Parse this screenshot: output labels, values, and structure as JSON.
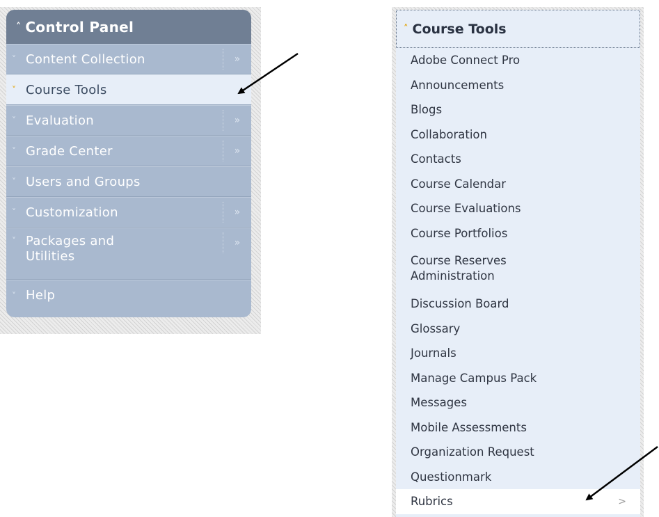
{
  "control_panel": {
    "title": "Control Panel",
    "items": [
      {
        "label": "Content Collection",
        "flyout": "»"
      },
      {
        "label": "Course Tools",
        "flyout": ""
      },
      {
        "label": "Evaluation",
        "flyout": "»"
      },
      {
        "label": "Grade Center",
        "flyout": "»"
      },
      {
        "label": "Users and Groups",
        "flyout": ""
      },
      {
        "label": "Customization",
        "flyout": "»"
      },
      {
        "label": "Packages and Utilities",
        "flyout": "»"
      },
      {
        "label": "Help",
        "flyout": ""
      }
    ],
    "active_item": "Course Tools"
  },
  "course_tools": {
    "title": "Course Tools",
    "items": [
      {
        "label": "Adobe Connect Pro"
      },
      {
        "label": "Announcements"
      },
      {
        "label": "Blogs"
      },
      {
        "label": "Collaboration"
      },
      {
        "label": "Contacts"
      },
      {
        "label": "Course Calendar"
      },
      {
        "label": "Course Evaluations"
      },
      {
        "label": "Course Portfolios"
      },
      {
        "label": "Course Reserves Administration"
      },
      {
        "label": "Discussion Board"
      },
      {
        "label": "Glossary"
      },
      {
        "label": "Journals"
      },
      {
        "label": "Manage Campus Pack"
      },
      {
        "label": "Messages"
      },
      {
        "label": "Mobile Assessments"
      },
      {
        "label": "Organization Request"
      },
      {
        "label": "Questionmark"
      },
      {
        "label": "Rubrics",
        "caret": ">"
      }
    ],
    "highlighted_item": "Rubrics"
  },
  "icons": {
    "collapse": "chevron-up-icon",
    "expand": "chevron-down-icon",
    "flyout": "double-chevron-right-icon",
    "pointer": "arrow-pointer"
  },
  "colors": {
    "panel_bg": "#a9b9cf",
    "panel_header": "#707f94",
    "active_bg": "#e7eef8",
    "accent_chevron": "#e3a200"
  }
}
